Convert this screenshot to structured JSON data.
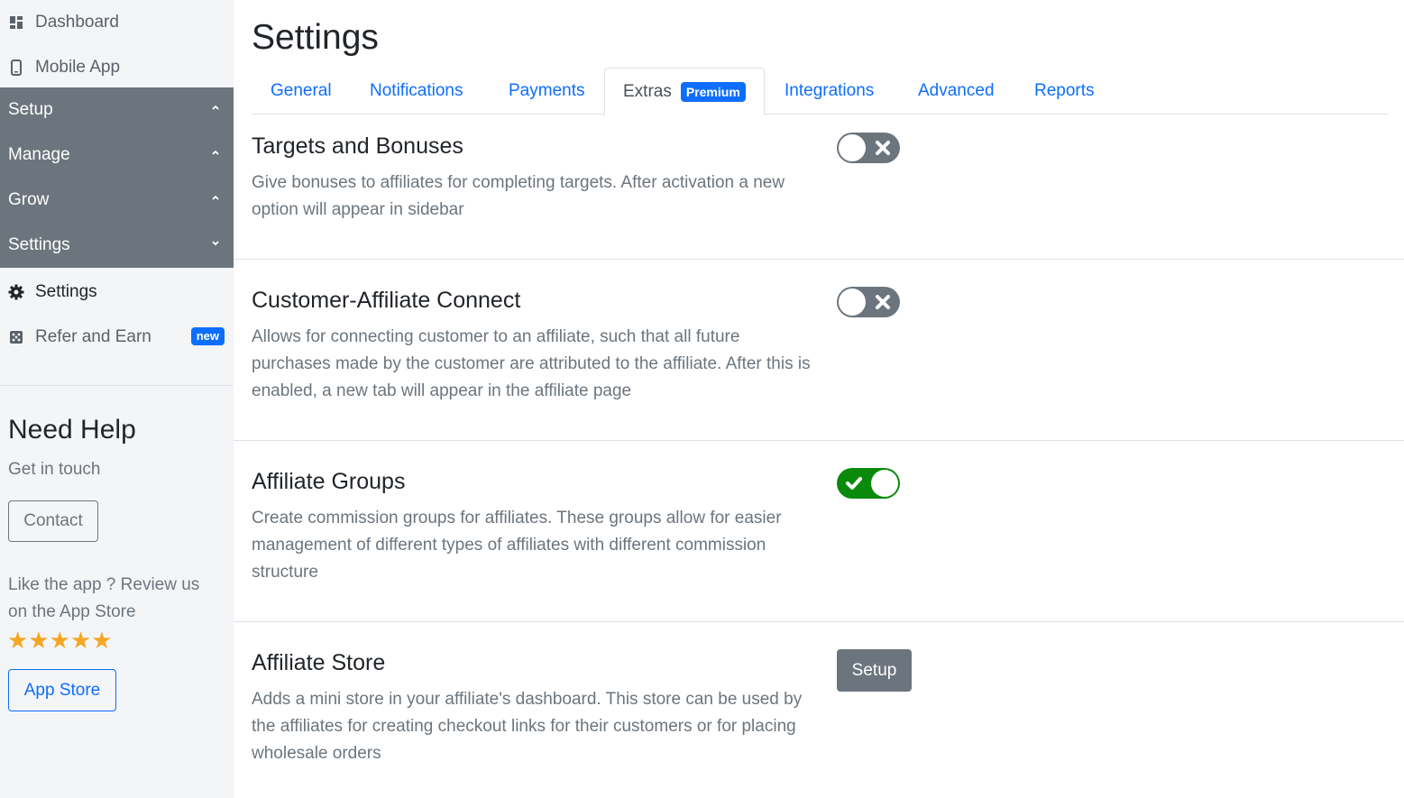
{
  "sidebar": {
    "items": [
      {
        "label": "Dashboard",
        "icon": "dashboard-icon"
      },
      {
        "label": "Mobile App",
        "icon": "mobile-icon"
      },
      {
        "label": "Setup",
        "state": "collapsed"
      },
      {
        "label": "Manage",
        "state": "collapsed"
      },
      {
        "label": "Grow",
        "state": "collapsed"
      },
      {
        "label": "Settings",
        "state": "expanded"
      },
      {
        "label": "Settings",
        "icon": "gear-icon"
      },
      {
        "label": "Refer and Earn",
        "icon": "dice-icon",
        "badge": "new"
      }
    ],
    "help": {
      "title": "Need Help",
      "subtitle": "Get in touch",
      "contact_label": "Contact",
      "review_text": "Like the app ? Review us on the App Store",
      "stars": "★★★★★",
      "rating": 5,
      "appstore_label": "App Store"
    }
  },
  "main": {
    "title": "Settings",
    "tabs": [
      {
        "label": "General"
      },
      {
        "label": "Notifications"
      },
      {
        "label": "Payments"
      },
      {
        "label": "Extras",
        "badge": "Premium",
        "active": true
      },
      {
        "label": "Integrations"
      },
      {
        "label": "Advanced"
      },
      {
        "label": "Reports"
      }
    ],
    "features": [
      {
        "title": "Targets and Bonuses",
        "description": "Give bonuses to affiliates for completing targets. After activation a new option will appear in sidebar",
        "enabled": false
      },
      {
        "title": "Customer-Affiliate Connect",
        "description": "Allows for connecting customer to an affiliate, such that all future purchases made by the customer are attributed to the affiliate. After this is enabled, a new tab will appear in the affiliate page",
        "enabled": false
      },
      {
        "title": "Affiliate Groups",
        "description": "Create commission groups for affiliates. These groups allow for easier management of different types of affiliates with different commission structure",
        "enabled": true
      },
      {
        "title": "Affiliate Store",
        "description": "Adds a mini store in your affiliate's dashboard. This store can be used by the affiliates for creating checkout links for their customers or for placing wholesale orders",
        "button_label": "Setup"
      }
    ]
  },
  "colors": {
    "primary": "#0d6efd",
    "sidebar_dark": "#6c757d",
    "toggle_on": "#0a8a0a",
    "toggle_off": "#6c757d",
    "star": "#f5a623"
  }
}
